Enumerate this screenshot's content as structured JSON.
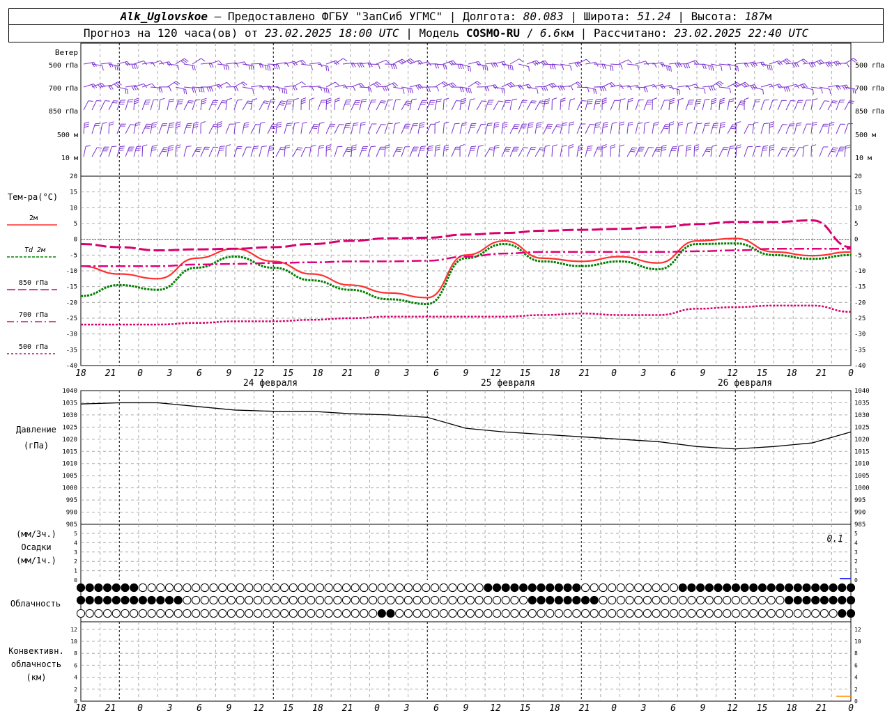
{
  "header": {
    "station": "Alk_Uglovskoe",
    "dash": " — ",
    "provider": "Предоставлено ФГБУ \"ЗапСиб УГМС\"",
    "sep": " | ",
    "lon_label": "Долгота: ",
    "lon_value": "80.083",
    "lat_label": "Широта: ",
    "lat_value": "51.24",
    "alt_label": "Высота: ",
    "alt_value": "187",
    "alt_unit": "м",
    "forecast_label": "Прогноз на 120 часа(ов) от ",
    "forecast_time": "23.02.2025 18:00 UTC",
    "model_label": " | Модель ",
    "model_name": "COSMO-RU",
    "model_res_sep": " / ",
    "model_res": "6.6",
    "model_res_unit": "км",
    "computed_label": " | Рассчитано: ",
    "computed_time": "23.02.2025 22:40 UTC"
  },
  "time_axis": {
    "hour_labels": [
      "18",
      "21",
      "0",
      "3",
      "6",
      "9",
      "12",
      "15",
      "18",
      "21",
      "0",
      "3",
      "6",
      "9",
      "12",
      "15",
      "18",
      "21",
      "0",
      "3",
      "6",
      "9",
      "12",
      "15",
      "18",
      "21",
      "0"
    ],
    "day_labels": [
      "24 февраля",
      "25 февраля",
      "26 февраля"
    ]
  },
  "wind": {
    "title": "Ветер",
    "levels": [
      "500 гПа",
      "700 гПа",
      "850 гПа",
      "500 м",
      "10  м"
    ]
  },
  "temperature": {
    "title": "Тем-ра(°С)",
    "legend": [
      {
        "label": "2м",
        "color": "#ff2a2a"
      },
      {
        "label": "Td  2м",
        "color": "#008000"
      },
      {
        "label": "850 гПа",
        "color": "#cc007a"
      },
      {
        "label": "700 гПа",
        "color": "#e0007a"
      },
      {
        "label": "500 гПа",
        "color": "#cc0077"
      }
    ],
    "ticks": [
      "20",
      "15",
      "10",
      "5",
      "0",
      "-5",
      "-10",
      "-15",
      "-20",
      "-25",
      "-30",
      "-35",
      "-40"
    ]
  },
  "pressure": {
    "title": "Давление",
    "unit": "(гПа)",
    "ticks": [
      "1040",
      "1035",
      "1030",
      "1025",
      "1020",
      "1015",
      "1010",
      "1005",
      "1000",
      "995",
      "990",
      "985"
    ]
  },
  "precip": {
    "unit3": "(мм/3ч.)",
    "title": "Осадки",
    "unit1": "(мм/1ч.)",
    "ticks": [
      "5",
      "4",
      "3",
      "2",
      "1",
      "0"
    ],
    "max_label": "0.1"
  },
  "clouds": {
    "title": "Облачность"
  },
  "convective": {
    "title1": "Конвективн.",
    "title2": "облачность",
    "unit": "(км)",
    "ticks": [
      "12",
      "10",
      "8",
      "6",
      "4",
      "2",
      "0"
    ]
  },
  "chart_data": [
    {
      "type": "line",
      "name": "temperature",
      "x_hours": [
        0,
        6,
        12,
        18,
        24,
        30,
        36,
        42,
        48,
        54,
        60,
        66,
        72,
        78,
        84,
        90,
        96,
        102,
        108,
        114,
        120
      ],
      "series": [
        {
          "name": "2м",
          "values": [
            -8.5,
            -11,
            -12.5,
            -6,
            -3,
            -7,
            -11,
            -14.5,
            -17,
            -18.5,
            -5,
            -0.5,
            -6,
            -7,
            -5.5,
            -7.5,
            -0.5,
            0.3,
            -4,
            -5.2,
            -4
          ]
        },
        {
          "name": "Td  2м",
          "values": [
            -18,
            -14.5,
            -16,
            -9,
            -5.5,
            -9,
            -13,
            -16,
            -19,
            -20.5,
            -6,
            -1.5,
            -7,
            -8.5,
            -7,
            -9.5,
            -1.5,
            -1.3,
            -5,
            -6.2,
            -5
          ]
        },
        {
          "name": "850 гПа",
          "values": [
            -1.5,
            -2.5,
            -3.5,
            -3.2,
            -3,
            -2.5,
            -1.5,
            -0.5,
            0.3,
            0.5,
            1.5,
            2,
            2.7,
            3,
            3.3,
            3.8,
            4.8,
            5.5,
            5.5,
            6,
            -2.5
          ]
        },
        {
          "name": "700 гПа",
          "values": [
            -8.5,
            -8.5,
            -8.5,
            -8,
            -7.8,
            -7.5,
            -7.3,
            -7,
            -7,
            -6.8,
            -5.5,
            -4.5,
            -4,
            -4,
            -4,
            -4,
            -3.8,
            -3.5,
            -3,
            -3,
            -3
          ]
        },
        {
          "name": "500 гПа",
          "values": [
            -27,
            -27,
            -27,
            -26.5,
            -26,
            -26,
            -25.5,
            -25,
            -24.5,
            -24.5,
            -24.5,
            -24.5,
            -24,
            -23.5,
            -24,
            -24,
            -22,
            -21.5,
            -21,
            -21,
            -23
          ]
        }
      ],
      "ylim": [
        -40,
        20
      ]
    },
    {
      "type": "line",
      "name": "pressure",
      "x_hours": [
        0,
        6,
        12,
        18,
        24,
        30,
        36,
        42,
        48,
        54,
        60,
        66,
        72,
        78,
        84,
        90,
        96,
        102,
        108,
        114,
        120
      ],
      "values": [
        1034.5,
        1035,
        1035,
        1033.5,
        1032,
        1031.5,
        1031.5,
        1030.5,
        1030,
        1029,
        1024.5,
        1023,
        1022,
        1021,
        1020,
        1019,
        1017,
        1016,
        1017,
        1018.5,
        1023
      ],
      "ylim": [
        985,
        1040
      ]
    },
    {
      "type": "bar",
      "name": "precipitation",
      "note_value": 0.1,
      "ylim": [
        0,
        5
      ]
    }
  ]
}
